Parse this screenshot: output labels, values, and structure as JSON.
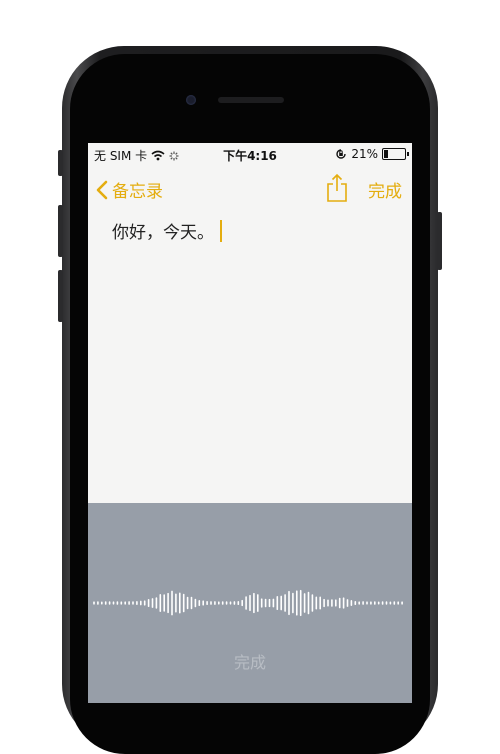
{
  "status_bar": {
    "carrier": "无 SIM 卡",
    "time": "下午4:16",
    "battery": "21%",
    "battery_level": 0.21
  },
  "nav": {
    "back_label": "备忘录",
    "done_label": "完成"
  },
  "note": {
    "text": "你好，今天。"
  },
  "dictation": {
    "done_label": "完成"
  },
  "colors": {
    "accent": "#e4ad0f",
    "dictation_bg": "#979ea8",
    "screen_bg": "#f5f5f4"
  },
  "icons": [
    "wifi-icon",
    "activity-icon",
    "orientation-lock-icon",
    "battery-icon",
    "back-chevron-icon",
    "share-icon",
    "waveform-icon"
  ]
}
